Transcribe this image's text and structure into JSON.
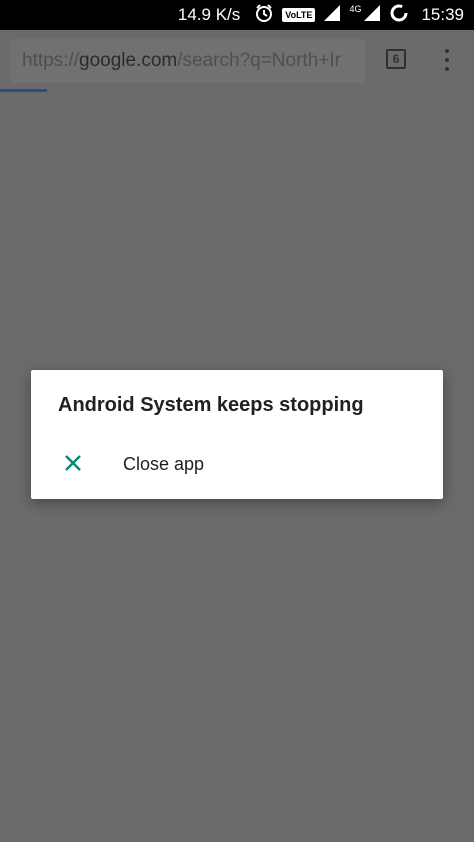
{
  "status_bar": {
    "net_speed": "14.9 K/s",
    "volte_label": "VoLTE",
    "network_label": "4G",
    "time": "15:39"
  },
  "browser": {
    "url_scheme": "https://",
    "url_domain": "google.com",
    "url_path": "/search?q=North+Ir",
    "tab_count": "6",
    "load_progress": 0.1
  },
  "dialog": {
    "title": "Android System keeps stopping",
    "option_label": "Close app",
    "accent_color": "#00897b"
  }
}
